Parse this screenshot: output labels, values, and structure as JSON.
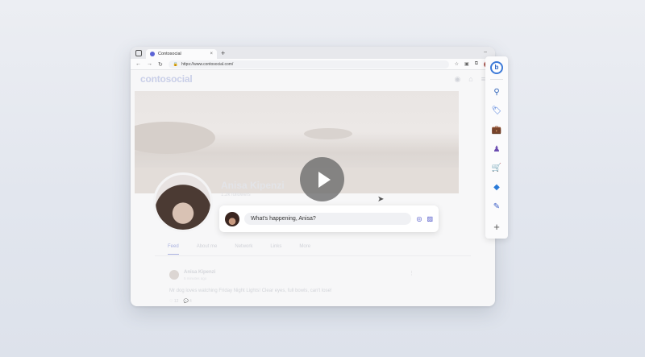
{
  "browser": {
    "tab_title": "Contosocial",
    "tab_close": "×",
    "new_tab": "+",
    "minimize": "–",
    "url": "https://www.contosocial.com/",
    "nav": {
      "back": "←",
      "forward": "→",
      "reload": "↻"
    }
  },
  "site": {
    "logo_text": "contosocial",
    "profile": {
      "name": "Anisa Kipenzi",
      "followers": "1.2k followers"
    },
    "composer": {
      "placeholder": "What's happening, Anisa?"
    },
    "tabs": [
      "Feed",
      "About me",
      "Network",
      "Links",
      "More"
    ],
    "feed_post": {
      "author": "Anisa Kipenzi",
      "time": "5 minutes ago",
      "text": "Mr dog loves watching Friday Night Lights! Clear eyes, full bowls, can't lose!",
      "reactions": "♡ 12",
      "comments": "💬 4"
    }
  },
  "sidebar": {
    "items": [
      "bing-chat",
      "search",
      "tag",
      "briefcase",
      "chess",
      "cart",
      "office",
      "edit"
    ],
    "add": "+"
  },
  "colors": {
    "accent": "#4b53c7",
    "bing_blue": "#3d7ad8"
  }
}
